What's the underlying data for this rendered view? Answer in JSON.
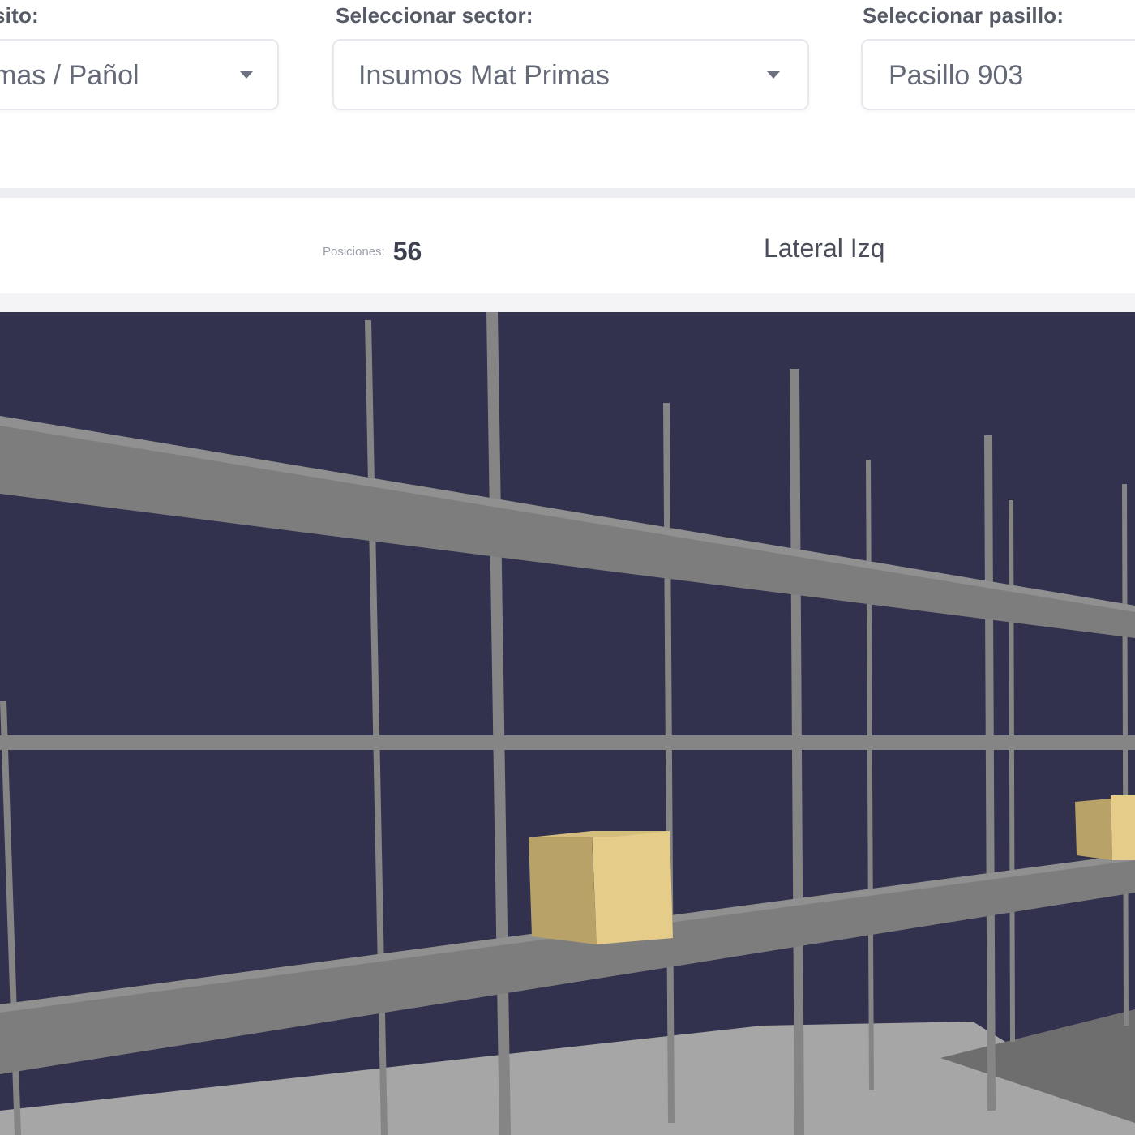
{
  "filters": {
    "site": {
      "label": "sito:",
      "value": "mas / Pañol"
    },
    "sector": {
      "label": "Seleccionar sector:",
      "value": "Insumos Mat Primas"
    },
    "aisle": {
      "label": "Seleccionar pasillo:",
      "value": "Pasillo 903"
    }
  },
  "info": {
    "aisle_number": "903",
    "positions_label": "Posiciones:",
    "positions_value": "56",
    "side": "Lateral Izq"
  },
  "viewport": {
    "background_color": "#32314e",
    "rack_color": "#858585",
    "box_color": "#e5cc89",
    "floor_color": "#a6a6a6"
  }
}
